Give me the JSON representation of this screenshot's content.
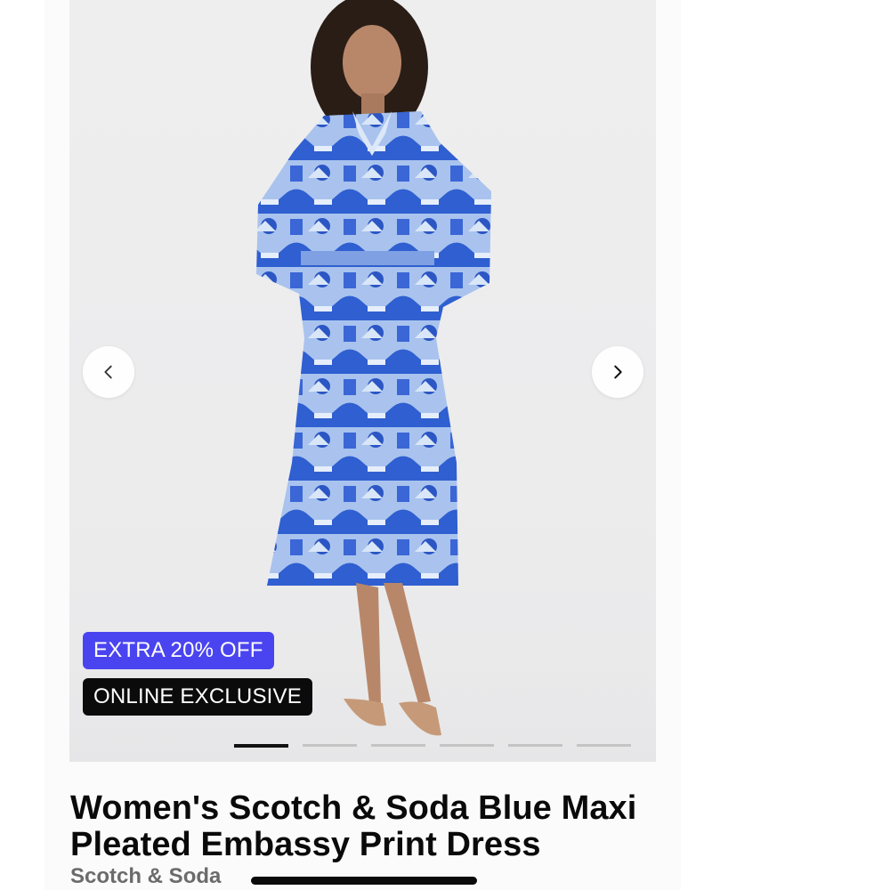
{
  "product": {
    "title": "Women's Scotch & Soda Blue Maxi Pleated Embassy Print Dress",
    "brand": "Scotch & Soda",
    "image_alt": "Model wearing a blue and white embassy print pleated maxi shirt dress with tan slingback heels"
  },
  "badges": {
    "discount": "EXTRA 20% OFF",
    "exclusive": "ONLINE EXCLUSIVE"
  },
  "gallery": {
    "image_count": 6,
    "active_index": 0,
    "prev_icon": "chevron-left-icon",
    "next_icon": "chevron-right-icon"
  },
  "colors": {
    "discount_badge": "#4a44f0",
    "exclusive_badge": "#0b0b0b",
    "active_dot": "#111111",
    "inactive_dot": "#c4c4c4",
    "dress_primary": "#2f5fd0",
    "dress_light": "#a9c3ee"
  }
}
